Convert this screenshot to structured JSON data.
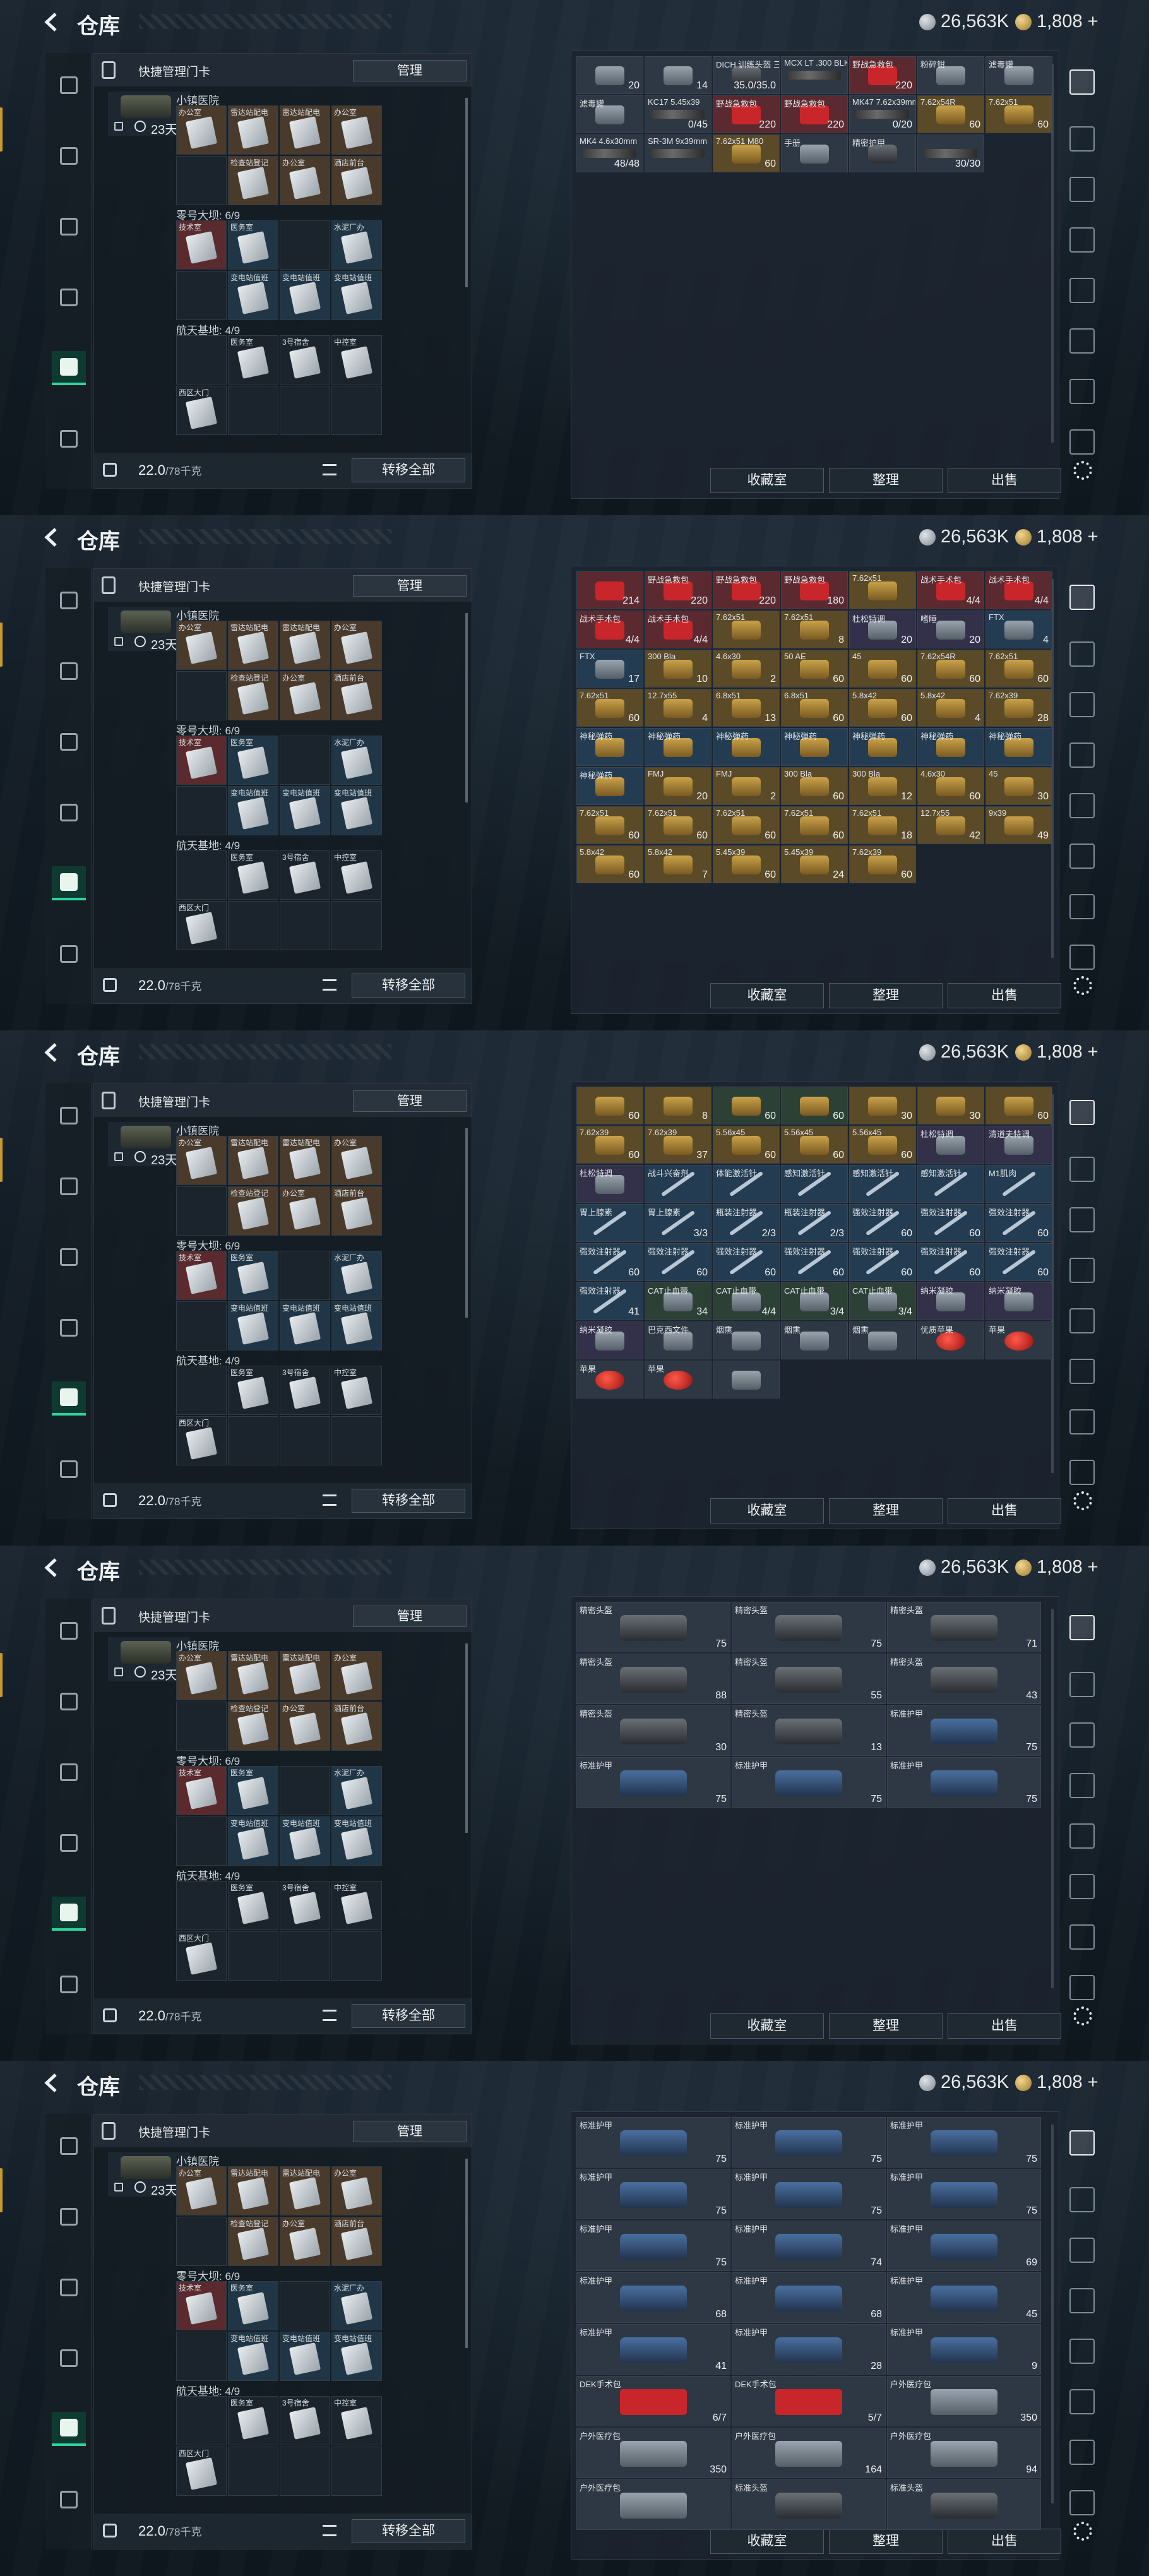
{
  "header": {
    "title": "仓库",
    "silver": "26,563K",
    "gold": "1,808",
    "gold_plus": "+"
  },
  "left_panel": {
    "title": "快捷管理门卡",
    "manage_label": "管理",
    "case_days": "23天",
    "sections": [
      {
        "label": "小镇医院",
        "cards": [
          "办公室",
          "雷达站配电",
          "雷达站配电",
          "办公室"
        ]
      },
      {
        "label": "",
        "cards": [
          "",
          "检查站登记",
          "办公室",
          "酒店前台"
        ]
      },
      {
        "label": "零号大坝: 6/9",
        "cards": [
          "技术室",
          "医务室",
          "",
          "水泥厂办"
        ]
      },
      {
        "label": "",
        "cards": [
          "",
          "变电站值班",
          "变电站值班",
          "变电站值班"
        ]
      },
      {
        "label": "航天基地: 4/9",
        "cards": [
          "",
          "医务室",
          "3号宿舍",
          "中控室"
        ]
      },
      {
        "label": "",
        "cards": [
          "西区大门",
          "",
          "",
          ""
        ]
      }
    ],
    "weight": "22.0",
    "weight_unit": "/78千克",
    "transfer_label": "转移全部"
  },
  "stash_buttons": [
    "收藏室",
    "整理",
    "出售"
  ],
  "screens": [
    {
      "cells": [
        {
          "n": "",
          "c": "20",
          "k": "misc",
          "bg": "gray"
        },
        {
          "n": "",
          "c": "14",
          "k": "misc",
          "bg": "gray"
        },
        {
          "n": "DICH 训练头盔 三角洲",
          "c": "35.0/35.0",
          "k": "armor",
          "bg": "gray"
        },
        {
          "n": "MCX LT .300 BLK",
          "c": "",
          "k": "weapon",
          "bg": "gray"
        },
        {
          "n": "野战急救包",
          "c": "220",
          "k": "medkit",
          "bg": "red"
        },
        {
          "n": "粉碎钳",
          "c": "",
          "k": "misc",
          "bg": "gray"
        },
        {
          "n": "滤毒罐",
          "c": "",
          "k": "misc",
          "bg": "gray"
        },
        {
          "n": "滤毒罐",
          "c": "",
          "k": "misc",
          "bg": "gray"
        },
        {
          "n": "KC17 5.45x39",
          "c": "0/45",
          "k": "weapon",
          "bg": "gray"
        },
        {
          "n": "野战急救包",
          "c": "220",
          "k": "medkit",
          "bg": "red"
        },
        {
          "n": "野战急救包",
          "c": "220",
          "k": "medkit",
          "bg": "red"
        },
        {
          "n": "MK47 7.62x39mm",
          "c": "0/20",
          "k": "weapon",
          "bg": "gray"
        },
        {
          "n": "7.62x54R",
          "c": "60",
          "k": "ammo",
          "bg": "gold"
        },
        {
          "n": "7.62x51",
          "c": "60",
          "k": "ammo",
          "bg": "gold"
        },
        {
          "n": "MK4 4.6x30mm",
          "c": "48/48",
          "k": "weapon",
          "bg": "gray"
        },
        {
          "n": "SR-3M 9x39mm",
          "c": "",
          "k": "weapon",
          "bg": "gray"
        },
        {
          "n": "7.62x51 M80",
          "c": "60",
          "k": "ammo",
          "bg": "gold"
        },
        {
          "n": "手册",
          "c": "",
          "k": "misc",
          "bg": "gray"
        },
        {
          "n": "精密护甲",
          "c": "",
          "k": "armor",
          "bg": "gray"
        },
        {
          "n": "",
          "c": "30/30",
          "k": "weapon",
          "bg": "gray"
        }
      ]
    },
    {
      "cells": [
        {
          "n": "",
          "c": "214",
          "k": "medkit",
          "bg": "red"
        },
        {
          "n": "野战急救包",
          "c": "220",
          "k": "medkit",
          "bg": "red"
        },
        {
          "n": "野战急救包",
          "c": "220",
          "k": "medkit",
          "bg": "red"
        },
        {
          "n": "野战急救包",
          "c": "180",
          "k": "medkit",
          "bg": "red"
        },
        {
          "n": "7.62x51",
          "c": "",
          "k": "ammo",
          "bg": "gold"
        },
        {
          "n": "战术手术包",
          "c": "4/4",
          "k": "medkit",
          "bg": "red"
        },
        {
          "n": "战术手术包",
          "c": "4/4",
          "k": "medkit",
          "bg": "red"
        },
        {
          "n": "战术手术包",
          "c": "4/4",
          "k": "medkit",
          "bg": "red"
        },
        {
          "n": "战术手术包",
          "c": "4/4",
          "k": "medkit",
          "bg": "red"
        },
        {
          "n": "7.62x51",
          "c": "",
          "k": "ammo",
          "bg": "gold"
        },
        {
          "n": "7.62x51",
          "c": "8",
          "k": "ammo",
          "bg": "gold"
        },
        {
          "n": "杜松特调",
          "c": "20",
          "k": "misc",
          "bg": "purple"
        },
        {
          "n": "嗜睡",
          "c": "20",
          "k": "misc",
          "bg": "purple"
        },
        {
          "n": "FTX",
          "c": "4",
          "k": "misc",
          "bg": "blue"
        },
        {
          "n": "FTX",
          "c": "17",
          "k": "misc",
          "bg": "blue"
        },
        {
          "n": "300 Bla",
          "c": "10",
          "k": "ammo",
          "bg": "gold"
        },
        {
          "n": "4.6x30",
          "c": "2",
          "k": "ammo",
          "bg": "gold"
        },
        {
          "n": "50 AE",
          "c": "60",
          "k": "ammo",
          "bg": "gold"
        },
        {
          "n": "45",
          "c": "60",
          "k": "ammo",
          "bg": "gold"
        },
        {
          "n": "7.62x54R",
          "c": "60",
          "k": "ammo",
          "bg": "gold"
        },
        {
          "n": "7.62x51",
          "c": "60",
          "k": "ammo",
          "bg": "gold"
        },
        {
          "n": "7.62x51",
          "c": "60",
          "k": "ammo",
          "bg": "gold"
        },
        {
          "n": "12.7x55",
          "c": "4",
          "k": "ammo",
          "bg": "gold"
        },
        {
          "n": "6.8x51",
          "c": "13",
          "k": "ammo",
          "bg": "gold"
        },
        {
          "n": "6.8x51",
          "c": "60",
          "k": "ammo",
          "bg": "gold"
        },
        {
          "n": "5.8x42",
          "c": "60",
          "k": "ammo",
          "bg": "gold"
        },
        {
          "n": "5.8x42",
          "c": "4",
          "k": "ammo",
          "bg": "gold"
        },
        {
          "n": "7.62x39",
          "c": "28",
          "k": "ammo",
          "bg": "gold"
        },
        {
          "n": "神秘弹药",
          "c": "",
          "k": "ammo",
          "bg": "blue"
        },
        {
          "n": "神秘弹药",
          "c": "",
          "k": "ammo",
          "bg": "blue"
        },
        {
          "n": "神秘弹药",
          "c": "",
          "k": "ammo",
          "bg": "blue"
        },
        {
          "n": "神秘弹药",
          "c": "",
          "k": "ammo",
          "bg": "blue"
        },
        {
          "n": "神秘弹药",
          "c": "",
          "k": "ammo",
          "bg": "blue"
        },
        {
          "n": "神秘弹药",
          "c": "",
          "k": "ammo",
          "bg": "blue"
        },
        {
          "n": "神秘弹药",
          "c": "",
          "k": "ammo",
          "bg": "blue"
        },
        {
          "n": "神秘弹药",
          "c": "",
          "k": "ammo",
          "bg": "blue"
        },
        {
          "n": "FMJ",
          "c": "20",
          "k": "ammo",
          "bg": "gold"
        },
        {
          "n": "FMJ",
          "c": "2",
          "k": "ammo",
          "bg": "gold"
        },
        {
          "n": "300 Bla",
          "c": "60",
          "k": "ammo",
          "bg": "gold"
        },
        {
          "n": "300 Bla",
          "c": "12",
          "k": "ammo",
          "bg": "gold"
        },
        {
          "n": "4.6x30",
          "c": "60",
          "k": "ammo",
          "bg": "gold"
        },
        {
          "n": "45",
          "c": "30",
          "k": "ammo",
          "bg": "gold"
        },
        {
          "n": "7.62x51",
          "c": "60",
          "k": "ammo",
          "bg": "gold"
        },
        {
          "n": "7.62x51",
          "c": "60",
          "k": "ammo",
          "bg": "gold"
        },
        {
          "n": "7.62x51",
          "c": "60",
          "k": "ammo",
          "bg": "gold"
        },
        {
          "n": "7.62x51",
          "c": "60",
          "k": "ammo",
          "bg": "gold"
        },
        {
          "n": "7.62x51",
          "c": "18",
          "k": "ammo",
          "bg": "gold"
        },
        {
          "n": "12.7x55",
          "c": "42",
          "k": "ammo",
          "bg": "gold"
        },
        {
          "n": "9x39",
          "c": "49",
          "k": "ammo",
          "bg": "gold"
        },
        {
          "n": "5.8x42",
          "c": "60",
          "k": "ammo",
          "bg": "gold"
        },
        {
          "n": "5.8x42",
          "c": "7",
          "k": "ammo",
          "bg": "gold"
        },
        {
          "n": "5.45x39",
          "c": "60",
          "k": "ammo",
          "bg": "gold"
        },
        {
          "n": "5.45x39",
          "c": "24",
          "k": "ammo",
          "bg": "gold"
        },
        {
          "n": "7.62x39",
          "c": "60",
          "k": "ammo",
          "bg": "gold"
        }
      ]
    },
    {
      "cells": [
        {
          "n": "",
          "c": "60",
          "k": "ammo",
          "bg": "gold"
        },
        {
          "n": "",
          "c": "8",
          "k": "ammo",
          "bg": "gold"
        },
        {
          "n": "",
          "c": "60",
          "k": "ammo",
          "bg": "green"
        },
        {
          "n": "",
          "c": "60",
          "k": "ammo",
          "bg": "green"
        },
        {
          "n": "",
          "c": "30",
          "k": "ammo",
          "bg": "gold"
        },
        {
          "n": "",
          "c": "30",
          "k": "ammo",
          "bg": "gold"
        },
        {
          "n": "",
          "c": "60",
          "k": "ammo",
          "bg": "gold"
        },
        {
          "n": "7.62x39",
          "c": "60",
          "k": "ammo",
          "bg": "gold"
        },
        {
          "n": "7.62x39",
          "c": "37",
          "k": "ammo",
          "bg": "gold"
        },
        {
          "n": "5.56x45",
          "c": "60",
          "k": "ammo",
          "bg": "gold"
        },
        {
          "n": "5.56x45",
          "c": "60",
          "k": "ammo",
          "bg": "gold"
        },
        {
          "n": "5.56x45",
          "c": "60",
          "k": "ammo",
          "bg": "gold"
        },
        {
          "n": "杜松特调",
          "c": "",
          "k": "misc",
          "bg": "purple"
        },
        {
          "n": "清道夫特调",
          "c": "",
          "k": "misc",
          "bg": "purple"
        },
        {
          "n": "杜松特调",
          "c": "",
          "k": "misc",
          "bg": "purple"
        },
        {
          "n": "战斗兴奋剂",
          "c": "",
          "k": "syringe",
          "bg": "blue"
        },
        {
          "n": "体能激活针",
          "c": "",
          "k": "syringe",
          "bg": "blue"
        },
        {
          "n": "感知激活针",
          "c": "",
          "k": "syringe",
          "bg": "blue"
        },
        {
          "n": "感知激活针",
          "c": "",
          "k": "syringe",
          "bg": "blue"
        },
        {
          "n": "感知激活针",
          "c": "",
          "k": "syringe",
          "bg": "blue"
        },
        {
          "n": "M1肌肉",
          "c": "",
          "k": "syringe",
          "bg": "blue"
        },
        {
          "n": "胃上腺素",
          "c": "",
          "k": "syringe",
          "bg": "blue"
        },
        {
          "n": "胃上腺素",
          "c": "3/3",
          "k": "syringe",
          "bg": "blue"
        },
        {
          "n": "瓶装注射器",
          "c": "2/3",
          "k": "syringe",
          "bg": "blue"
        },
        {
          "n": "瓶装注射器",
          "c": "2/3",
          "k": "syringe",
          "bg": "blue"
        },
        {
          "n": "强效注射器",
          "c": "60",
          "k": "syringe",
          "bg": "blue"
        },
        {
          "n": "强效注射器",
          "c": "60",
          "k": "syringe",
          "bg": "blue"
        },
        {
          "n": "强效注射器",
          "c": "60",
          "k": "syringe",
          "bg": "blue"
        },
        {
          "n": "强效注射器",
          "c": "60",
          "k": "syringe",
          "bg": "blue"
        },
        {
          "n": "强效注射器",
          "c": "60",
          "k": "syringe",
          "bg": "blue"
        },
        {
          "n": "强效注射器",
          "c": "60",
          "k": "syringe",
          "bg": "blue"
        },
        {
          "n": "强效注射器",
          "c": "60",
          "k": "syringe",
          "bg": "blue"
        },
        {
          "n": "强效注射器",
          "c": "60",
          "k": "syringe",
          "bg": "blue"
        },
        {
          "n": "强效注射器",
          "c": "60",
          "k": "syringe",
          "bg": "blue"
        },
        {
          "n": "强效注射器",
          "c": "60",
          "k": "syringe",
          "bg": "blue"
        },
        {
          "n": "强效注射器",
          "c": "41",
          "k": "syringe",
          "bg": "blue"
        },
        {
          "n": "CAT止血带",
          "c": "34",
          "k": "misc",
          "bg": "green"
        },
        {
          "n": "CAT止血带",
          "c": "4/4",
          "k": "misc",
          "bg": "green"
        },
        {
          "n": "CAT止血带",
          "c": "3/4",
          "k": "misc",
          "bg": "green"
        },
        {
          "n": "CAT止血带",
          "c": "3/4",
          "k": "misc",
          "bg": "green"
        },
        {
          "n": "纳米凝胶",
          "c": "",
          "k": "misc",
          "bg": "purple"
        },
        {
          "n": "纳米凝胶",
          "c": "",
          "k": "misc",
          "bg": "purple"
        },
        {
          "n": "纳米凝胶",
          "c": "",
          "k": "misc",
          "bg": "purple"
        },
        {
          "n": "巴克西文件",
          "c": "",
          "k": "misc",
          "bg": "gray"
        },
        {
          "n": "烟熏",
          "c": "",
          "k": "misc",
          "bg": "gray"
        },
        {
          "n": "烟熏",
          "c": "",
          "k": "misc",
          "bg": "gray"
        },
        {
          "n": "烟熏",
          "c": "",
          "k": "misc",
          "bg": "gray"
        },
        {
          "n": "优质苹果",
          "c": "",
          "k": "apple",
          "bg": "gray"
        },
        {
          "n": "苹果",
          "c": "",
          "k": "apple",
          "bg": "gray"
        },
        {
          "n": "苹果",
          "c": "",
          "k": "apple",
          "bg": "gray"
        },
        {
          "n": "苹果",
          "c": "",
          "k": "apple",
          "bg": "gray"
        },
        {
          "n": "",
          "c": "",
          "k": "misc",
          "bg": "gray"
        }
      ]
    },
    {
      "cells": [
        {
          "n": "精密头盔",
          "c": "75",
          "k": "armor",
          "bg": "gray"
        },
        {
          "n": "精密头盔",
          "c": "75",
          "k": "armor",
          "bg": "gray"
        },
        {
          "n": "精密头盔",
          "c": "71",
          "k": "armor",
          "bg": "gray"
        },
        {
          "n": "精密头盔",
          "c": "88",
          "k": "armor",
          "bg": "gray"
        },
        {
          "n": "精密头盔",
          "c": "55",
          "k": "armor",
          "bg": "gray"
        },
        {
          "n": "精密头盔",
          "c": "43",
          "k": "armor",
          "bg": "gray"
        },
        {
          "n": "精密头盔",
          "c": "30",
          "k": "armor",
          "bg": "gray"
        },
        {
          "n": "精密头盔",
          "c": "13",
          "k": "armor",
          "bg": "gray"
        },
        {
          "n": "标准护甲",
          "c": "75",
          "k": "armor-blue",
          "bg": "gray"
        },
        {
          "n": "标准护甲",
          "c": "75",
          "k": "armor-blue",
          "bg": "gray"
        },
        {
          "n": "标准护甲",
          "c": "75",
          "k": "armor-blue",
          "bg": "gray"
        },
        {
          "n": "标准护甲",
          "c": "75",
          "k": "armor-blue",
          "bg": "gray"
        }
      ]
    },
    {
      "cells": [
        {
          "n": "标准护甲",
          "c": "75",
          "k": "armor-blue",
          "bg": "gray"
        },
        {
          "n": "标准护甲",
          "c": "75",
          "k": "armor-blue",
          "bg": "gray"
        },
        {
          "n": "标准护甲",
          "c": "75",
          "k": "armor-blue",
          "bg": "gray"
        },
        {
          "n": "标准护甲",
          "c": "75",
          "k": "armor-blue",
          "bg": "gray"
        },
        {
          "n": "标准护甲",
          "c": "75",
          "k": "armor-blue",
          "bg": "gray"
        },
        {
          "n": "标准护甲",
          "c": "75",
          "k": "armor-blue",
          "bg": "gray"
        },
        {
          "n": "标准护甲",
          "c": "75",
          "k": "armor-blue",
          "bg": "gray"
        },
        {
          "n": "标准护甲",
          "c": "74",
          "k": "armor-blue",
          "bg": "gray"
        },
        {
          "n": "标准护甲",
          "c": "69",
          "k": "armor-blue",
          "bg": "gray"
        },
        {
          "n": "标准护甲",
          "c": "68",
          "k": "armor-blue",
          "bg": "gray"
        },
        {
          "n": "标准护甲",
          "c": "68",
          "k": "armor-blue",
          "bg": "gray"
        },
        {
          "n": "标准护甲",
          "c": "45",
          "k": "armor-blue",
          "bg": "gray"
        },
        {
          "n": "标准护甲",
          "c": "41",
          "k": "armor-blue",
          "bg": "gray"
        },
        {
          "n": "标准护甲",
          "c": "28",
          "k": "armor-blue",
          "bg": "gray"
        },
        {
          "n": "标准护甲",
          "c": "9",
          "k": "armor-blue",
          "bg": "gray"
        },
        {
          "n": "DEK手术包",
          "c": "6/7",
          "k": "medkit",
          "bg": "gray"
        },
        {
          "n": "DEK手术包",
          "c": "5/7",
          "k": "medkit",
          "bg": "gray"
        },
        {
          "n": "户外医疗包",
          "c": "350",
          "k": "misc",
          "bg": "gray"
        },
        {
          "n": "户外医疗包",
          "c": "350",
          "k": "misc",
          "bg": "gray"
        },
        {
          "n": "户外医疗包",
          "c": "164",
          "k": "misc",
          "bg": "gray"
        },
        {
          "n": "户外医疗包",
          "c": "94",
          "k": "misc",
          "bg": "gray"
        },
        {
          "n": "户外医疗包",
          "c": "",
          "k": "misc",
          "bg": "gray"
        },
        {
          "n": "标准头盔",
          "c": "",
          "k": "armor",
          "bg": "gray"
        },
        {
          "n": "标准头盔",
          "c": "",
          "k": "armor",
          "bg": "gray"
        }
      ]
    }
  ]
}
